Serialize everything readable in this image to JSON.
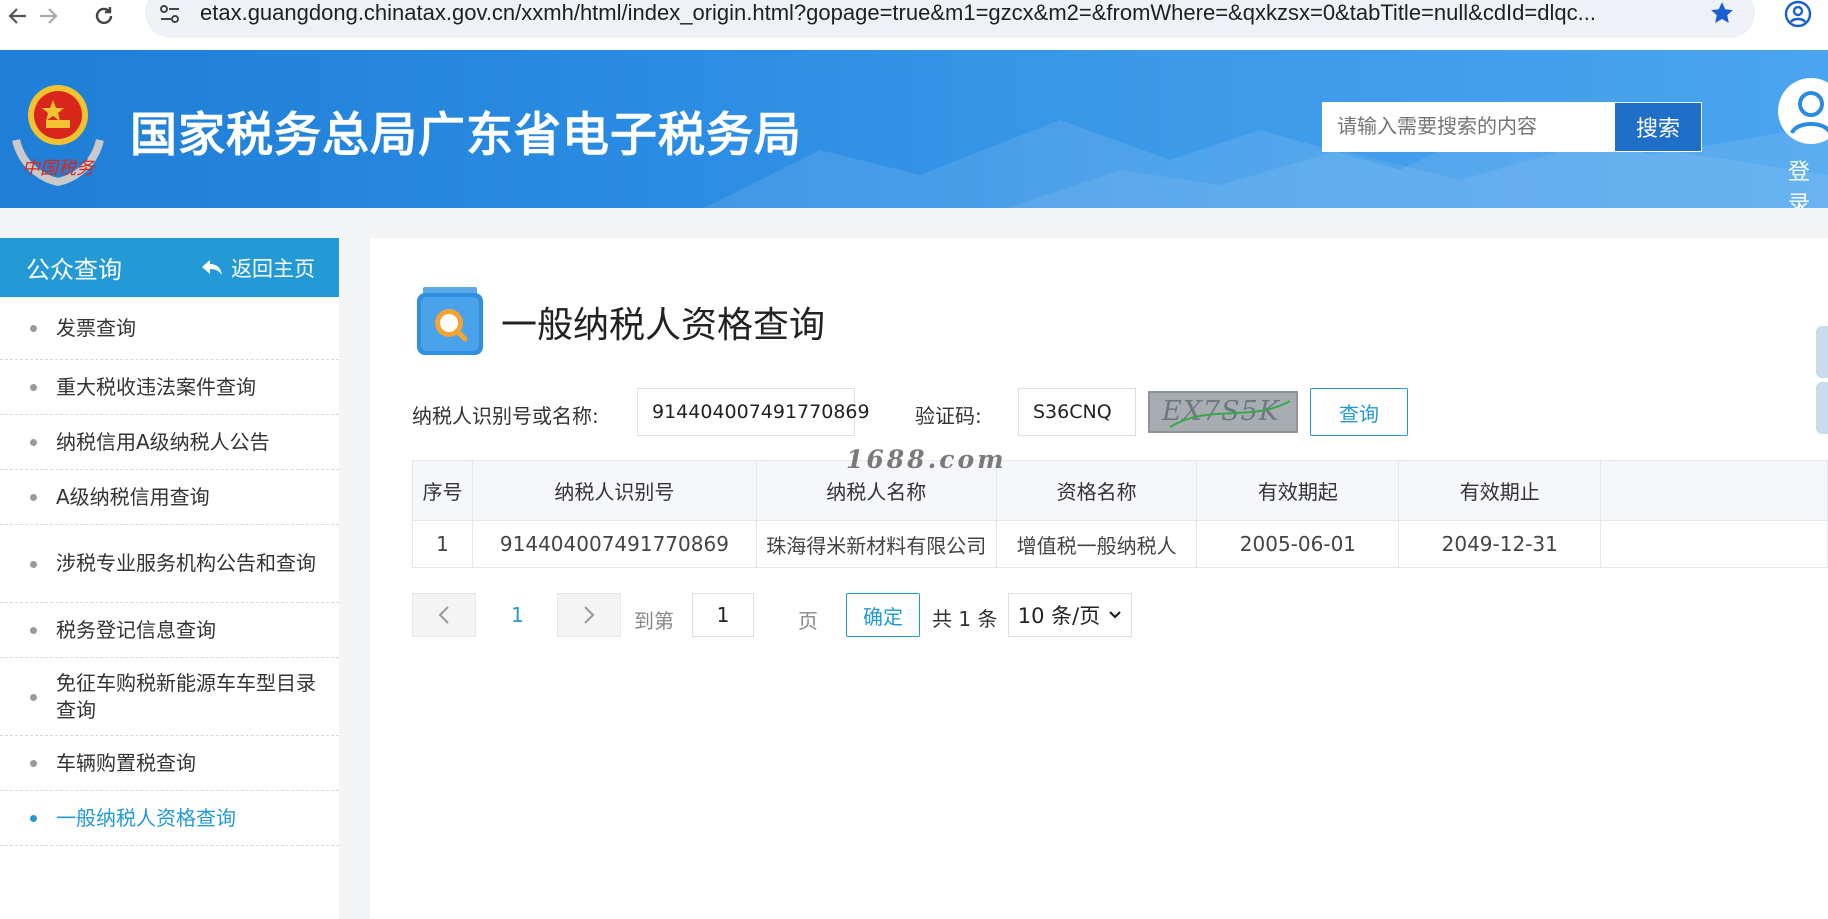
{
  "browser": {
    "url": "etax.guangdong.chinatax.gov.cn/xxmh/html/index_origin.html?gopage=true&m1=gzcx&m2=&fromWhere=&qxkzsx=0&tabTitle=null&cdId=dlqc..."
  },
  "header": {
    "site_title": "国家税务总局广东省电子税务局",
    "emblem_caption": "中国税务",
    "search_placeholder": "请输入需要搜索的内容",
    "search_button": "搜索",
    "login_label": "登录"
  },
  "sidebar": {
    "title": "公众查询",
    "back_label": "返回主页",
    "items": [
      {
        "label": "发票查询",
        "active": false
      },
      {
        "label": "重大税收违法案件查询",
        "active": false
      },
      {
        "label": "纳税信用A级纳税人公告",
        "active": false
      },
      {
        "label": "A级纳税信用查询",
        "active": false
      },
      {
        "label": "涉税专业服务机构公告和查询",
        "active": false
      },
      {
        "label": "税务登记信息查询",
        "active": false
      },
      {
        "label": "免征车购税新能源车车型目录查询",
        "active": false
      },
      {
        "label": "车辆购置税查询",
        "active": false
      },
      {
        "label": "一般纳税人资格查询",
        "active": true
      }
    ]
  },
  "main": {
    "page_title": "一般纳税人资格查询",
    "form": {
      "taxpayer_label": "纳税人识别号或名称:",
      "taxpayer_value": "914404007491770869",
      "captcha_label": "验证码:",
      "captcha_value": "S36CNQ",
      "captcha_image_text": "EX7S5K",
      "query_button": "查询"
    },
    "table": {
      "columns": [
        "序号",
        "纳税人识别号",
        "纳税人名称",
        "资格名称",
        "有效期起",
        "有效期止"
      ],
      "rows": [
        [
          "1",
          "914404007491770869",
          "珠海得米新材料有限公司",
          "增值税一般纳税人",
          "2005-06-01",
          "2049-12-31"
        ]
      ]
    },
    "pager": {
      "current_page": "1",
      "goto_label": "到第",
      "page_input": "1",
      "page_unit": "页",
      "confirm_button": "确定",
      "total_prefix": "共",
      "total_count": "1",
      "total_suffix": "条",
      "page_size": "10 条/页"
    }
  },
  "watermark": "1688.com",
  "colors": {
    "accent": "#2399d6",
    "banner": "#2a8be3",
    "search_button": "#1f6fc9"
  }
}
